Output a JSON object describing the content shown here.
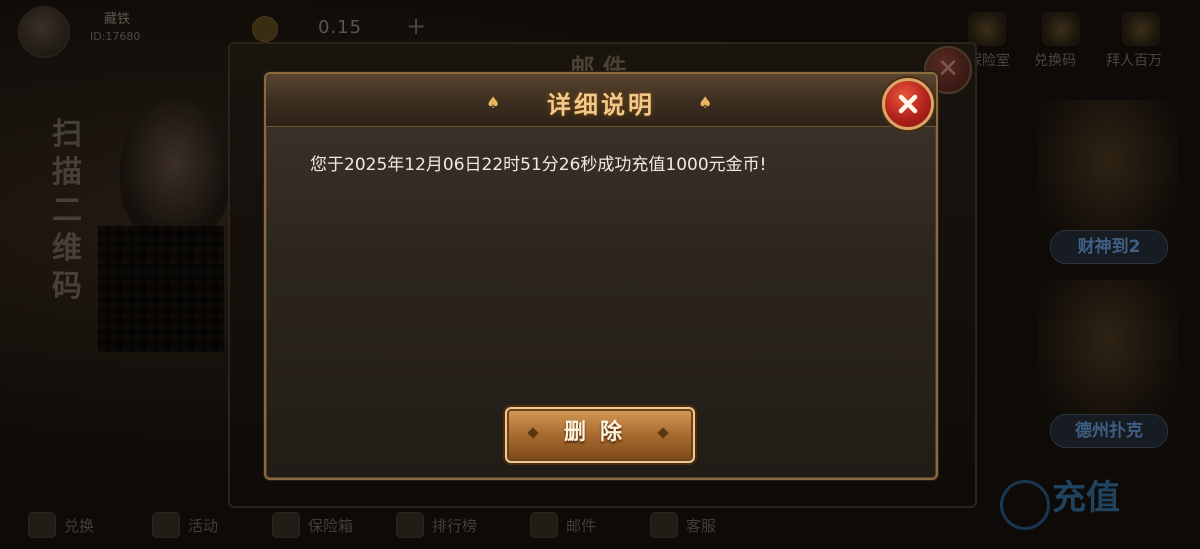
{
  "background": {
    "player": {
      "name": "藏铁",
      "id": "ID:17680"
    },
    "coins": {
      "amount": "0.15",
      "plus": "+"
    },
    "top_menu": [
      "保险室",
      "兑换码",
      "拜人百万"
    ],
    "side_promo": {
      "text": "扫描二维码"
    },
    "right_games": [
      {
        "label": "财神到2"
      },
      {
        "label": "德州扑克"
      }
    ],
    "recharge_label": "充值",
    "bottom_nav": [
      "兑换",
      "活动",
      "保险箱",
      "排行榜",
      "邮件",
      "客服"
    ]
  },
  "mail_window": {
    "title": "邮件"
  },
  "dialog": {
    "title": "详细说明",
    "message": "您于2025年12月06日22时51分26秒成功充值1000元金币!",
    "delete_label": "删除"
  },
  "icons": {
    "close": "close-icon",
    "spade": "spade-icon"
  },
  "colors": {
    "title_gold": "#f3c98b",
    "close_red": "#b2221a",
    "button_gold": "#d59a58"
  }
}
